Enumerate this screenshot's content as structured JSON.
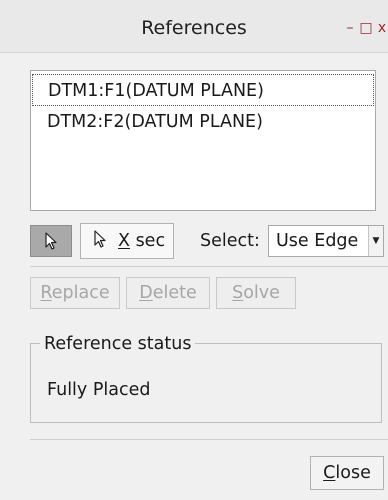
{
  "window": {
    "title": "References",
    "minimize_glyph": "–",
    "maximize_glyph": "□",
    "close_glyph": "x",
    "accent_color": "#a0272b"
  },
  "references": {
    "items": [
      {
        "label": "DTM1:F1(DATUM PLANE)",
        "selected": true
      },
      {
        "label": "DTM2:F2(DATUM PLANE)",
        "selected": false
      }
    ]
  },
  "toolbar": {
    "pick_icon": "pointer-arrow-icon",
    "xsec_icon": "pointer-arrow-icon",
    "xsec_label_mnemonic": "X",
    "xsec_label_rest": " sec",
    "select_label": "Select:",
    "select_value": "Use Edge"
  },
  "actions": {
    "replace": {
      "mnemonic": "R",
      "rest": "eplace"
    },
    "delete": {
      "mnemonic": "D",
      "rest": "elete"
    },
    "solve": {
      "mnemonic": "S",
      "rest": "olve"
    }
  },
  "status": {
    "group_label": "Reference status",
    "value": "Fully Placed"
  },
  "footer": {
    "close": {
      "mnemonic": "C",
      "rest": "lose"
    }
  }
}
